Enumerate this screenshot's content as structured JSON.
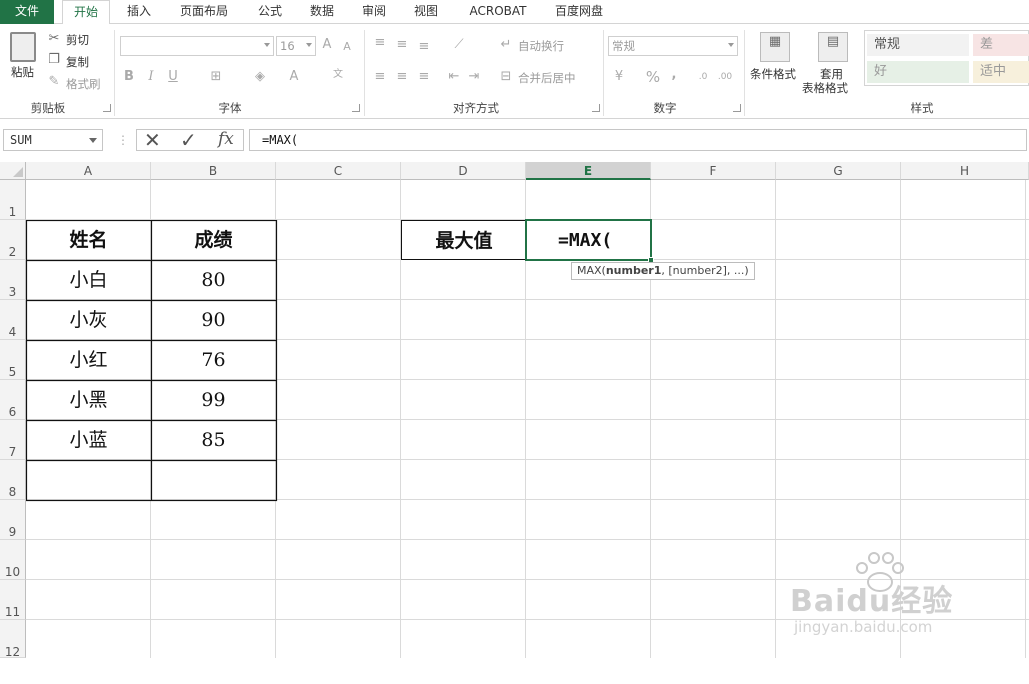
{
  "tabs": [
    "文件",
    "开始",
    "插入",
    "页面布局",
    "公式",
    "数据",
    "审阅",
    "视图",
    "ACROBAT",
    "百度网盘"
  ],
  "ribbon": {
    "clipboard": {
      "paste": "粘贴",
      "cut": "剪切",
      "copy": "复制",
      "format_painter": "格式刷",
      "label": "剪贴板"
    },
    "font": {
      "font_name": "",
      "font_size": "16",
      "bold": "B",
      "italic": "I",
      "underline": "U",
      "label": "字体"
    },
    "alignment": {
      "wrap": "自动换行",
      "merge": "合并后居中",
      "label": "对齐方式"
    },
    "number": {
      "format": "常规",
      "percent": "%",
      "comma": ",",
      "label": "数字"
    },
    "styles": {
      "conditional": "条件格式",
      "table_format_1": "套用",
      "table_format_2": "表格格式",
      "normal": "常规",
      "bad": "差",
      "good": "好",
      "neutral": "适中",
      "label": "样式"
    }
  },
  "formula_bar": {
    "name_box": "SUM",
    "cancel": "✕",
    "enter": "✓",
    "fx": "fx",
    "formula": "=MAX("
  },
  "columns": [
    "A",
    "B",
    "C",
    "D",
    "E",
    "F",
    "G",
    "H"
  ],
  "rows": [
    "1",
    "2",
    "3",
    "4",
    "5",
    "6",
    "7",
    "8",
    "9",
    "10",
    "11",
    "12"
  ],
  "table": {
    "headers": [
      "姓名",
      "成绩"
    ],
    "rows": [
      [
        "小白",
        "80"
      ],
      [
        "小灰",
        "90"
      ],
      [
        "小红",
        "76"
      ],
      [
        "小黑",
        "99"
      ],
      [
        "小蓝",
        "85"
      ]
    ]
  },
  "max_label": "最大值",
  "active_cell": {
    "address": "E2",
    "content": "=MAX("
  },
  "tooltip": {
    "fn": "MAX(",
    "arg1": "number1",
    "rest": ", [number2], ...)"
  },
  "watermark": {
    "line1": "Baidu经验",
    "line2": "jingyan.baidu.com"
  },
  "colors": {
    "accent": "#217346"
  }
}
